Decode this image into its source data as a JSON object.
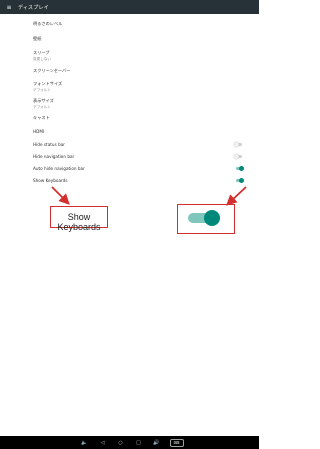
{
  "toolbar": {
    "title": "ディスプレイ",
    "menu_icon": "≡"
  },
  "settings": [
    {
      "label": "明るさのレベル",
      "summary": ""
    },
    {
      "label": "壁紙",
      "summary": ""
    },
    {
      "label": "スリープ",
      "summary": "変更しない"
    },
    {
      "label": "スクリーンセーバー",
      "summary": ""
    },
    {
      "label": "フォントサイズ",
      "summary": "デフォルト"
    },
    {
      "label": "表示サイズ",
      "summary": "デフォルト"
    },
    {
      "label": "キャスト",
      "summary": ""
    },
    {
      "label": "HDMI",
      "summary": ""
    }
  ],
  "toggles": [
    {
      "label": "Hide status bar",
      "state": "off"
    },
    {
      "label": "Hide navigation bar",
      "state": "off"
    },
    {
      "label": "Auto hide navigation bar",
      "state": "on"
    },
    {
      "label": "Show Keyboards",
      "state": "on"
    }
  ],
  "callout": {
    "text": "Show Keyboards",
    "toggle_state": "on"
  },
  "colors": {
    "toolbar": "#263238",
    "accent": "#00897b",
    "annotation": "#d32f2f"
  },
  "navbar": {
    "buttons": [
      {
        "icon": "volume-down-icon",
        "glyph": "🔈"
      },
      {
        "icon": "back-icon",
        "glyph": "◁"
      },
      {
        "icon": "home-icon",
        "glyph": "○"
      },
      {
        "icon": "recents-icon",
        "glyph": "□"
      },
      {
        "icon": "volume-up-icon",
        "glyph": "🔊"
      },
      {
        "icon": "keyboard-icon",
        "glyph": "⌨"
      }
    ]
  }
}
